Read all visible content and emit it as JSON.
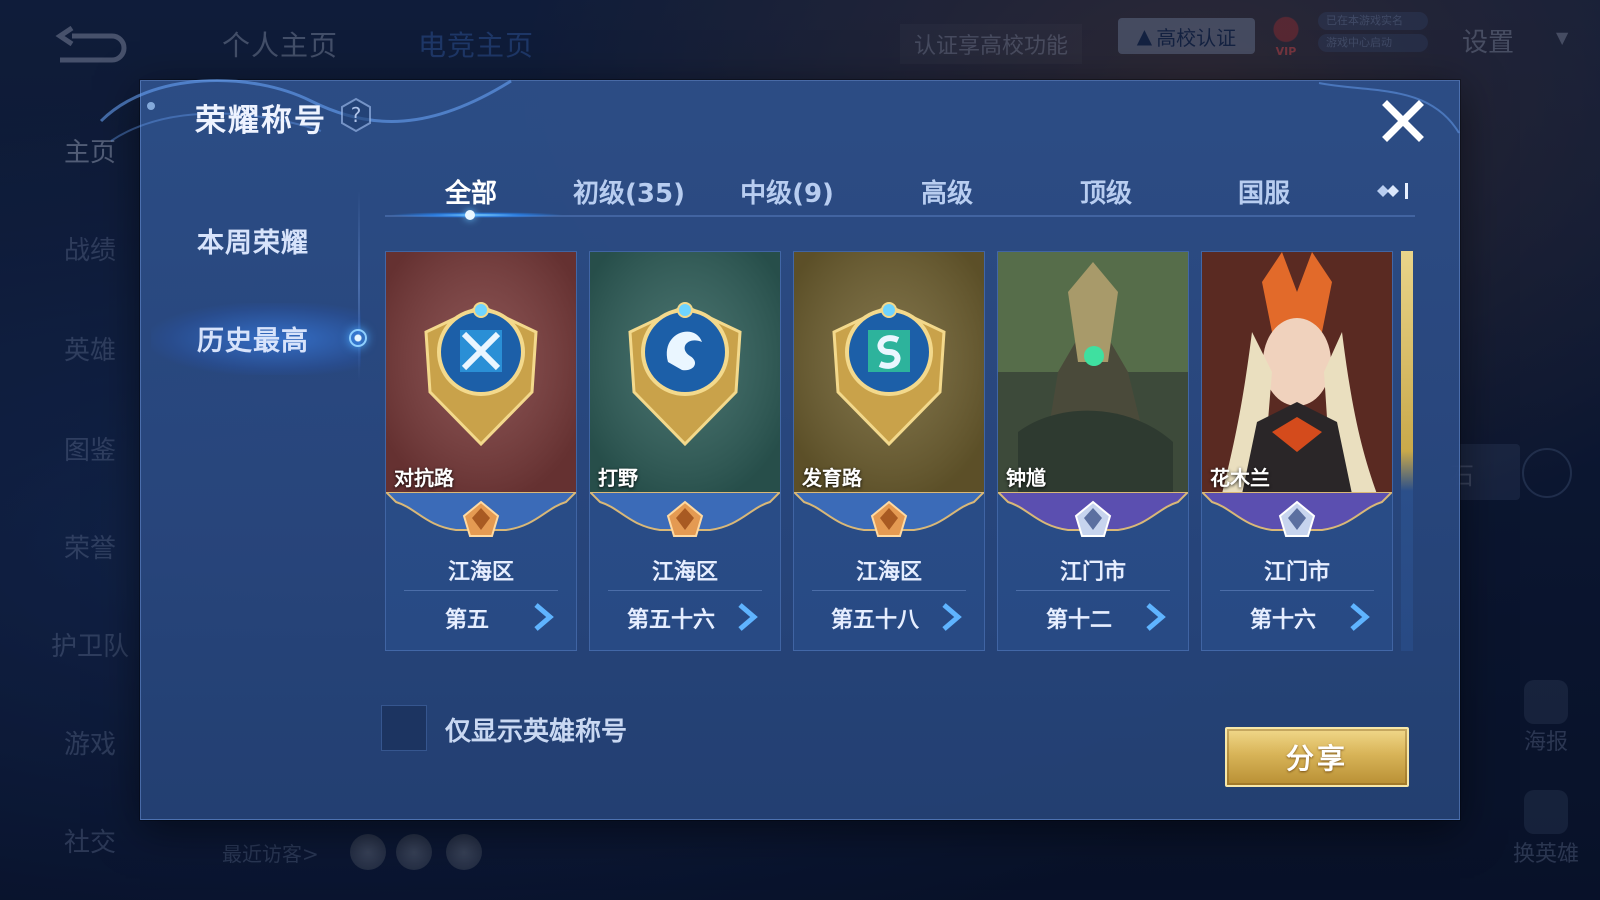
{
  "background": {
    "top_tabs": [
      "个人主页",
      "电竞主页"
    ],
    "cert_hint": "认证享高校功能",
    "campus_button": "高校认证",
    "vip_label": "VIP",
    "launch_lines": [
      "已在本游戏实名",
      "游戏中心启动"
    ],
    "settings": "设置",
    "nav_items": [
      "主页",
      "战绩",
      "英雄",
      "图鉴",
      "荣誉",
      "护卫队",
      "游戏",
      "社交"
    ],
    "visitors_label": "最近访客>",
    "right_actions": [
      "海报",
      "换英雄"
    ],
    "partial_label": "石"
  },
  "modal": {
    "title": "荣耀称号",
    "left_menu": [
      "本周荣耀",
      "历史最高"
    ],
    "active_menu_index": 1,
    "tabs": [
      "全部",
      "初级(35)",
      "中级(9)",
      "高级",
      "顶级",
      "国服"
    ],
    "active_tab_index": 0,
    "cards": [
      {
        "name": "对抗路",
        "region": "江海区",
        "rank": "第五",
        "tier": "bronze",
        "art": "lane-badge",
        "bg": "#7a3b3b"
      },
      {
        "name": "打野",
        "region": "江海区",
        "rank": "第五十六",
        "tier": "bronze",
        "art": "jungle-badge",
        "bg": "#2f5f5a"
      },
      {
        "name": "发育路",
        "region": "江海区",
        "rank": "第五十八",
        "tier": "bronze",
        "art": "carry-badge",
        "bg": "#6f6030"
      },
      {
        "name": "钟馗",
        "region": "江门市",
        "rank": "第十二",
        "tier": "silver",
        "art": "hero-zhongkui",
        "bg": "#3d4a3a"
      },
      {
        "name": "花木兰",
        "region": "江门市",
        "rank": "第十六",
        "tier": "silver",
        "art": "hero-mulan",
        "bg": "#5a2a22"
      }
    ],
    "checkbox_label": "仅显示英雄称号",
    "share_label": "分享"
  },
  "colors": {
    "modal_bg": "#2d4e87",
    "accent_blue": "#4aa8ff",
    "gold": "#d8b458",
    "bronze_banner": "#3b6bb8",
    "silver_banner": "#5b4fb0"
  }
}
